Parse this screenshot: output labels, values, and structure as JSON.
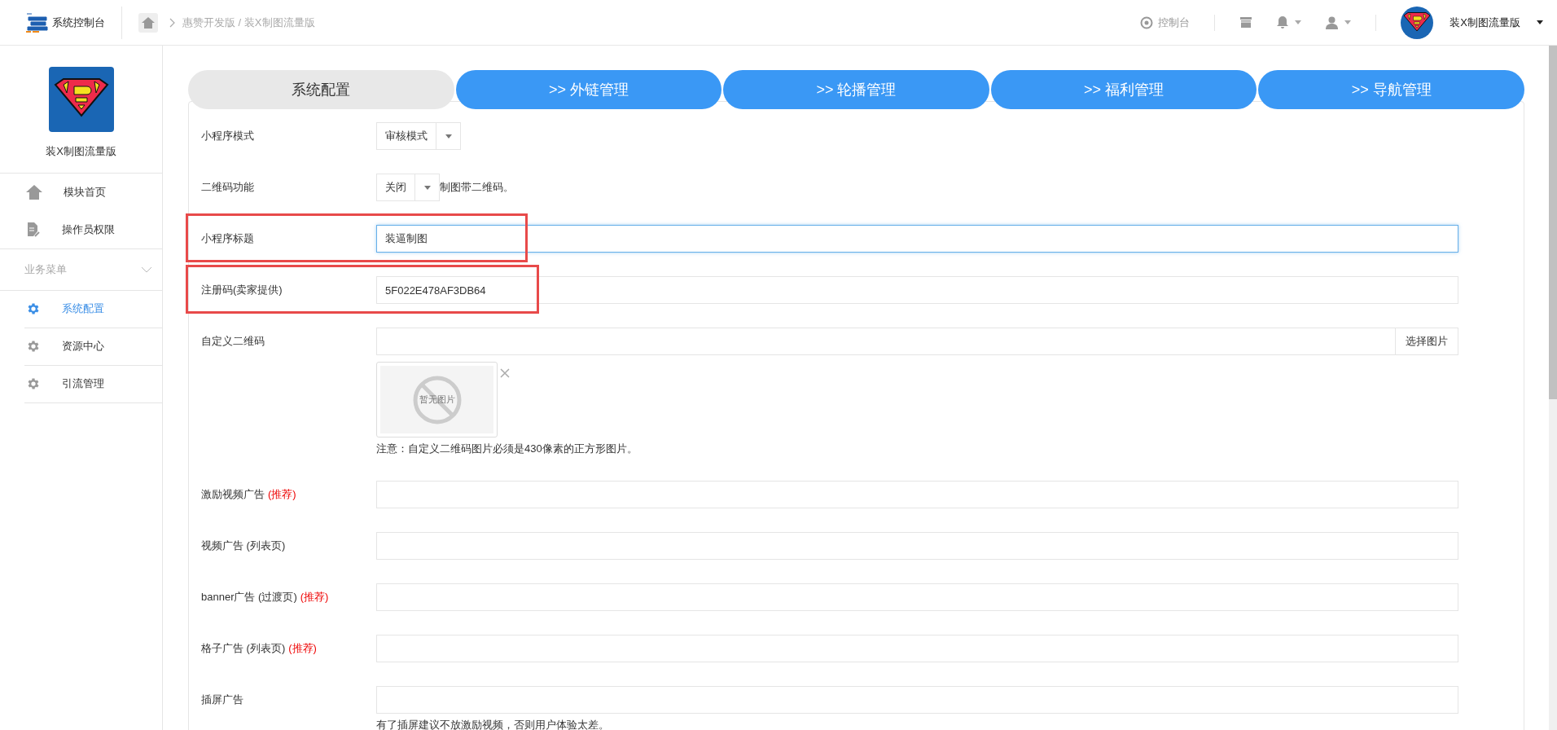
{
  "topbar": {
    "brand": "系统控制台",
    "breadcrumb": "惠赞开发版 / 装X制图流量版",
    "console": "控制台",
    "user_name": "装X制图流量版"
  },
  "sidebar": {
    "app_name": "装X制图流量版",
    "items": [
      {
        "label": "模块首页",
        "selected": false
      },
      {
        "label": "操作员权限",
        "selected": false
      }
    ],
    "section": {
      "label": "业务菜单",
      "expanded": true,
      "items": [
        {
          "label": "系统配置",
          "selected": true
        },
        {
          "label": "资源中心",
          "selected": false
        },
        {
          "label": "引流管理",
          "selected": false
        }
      ]
    }
  },
  "tabs": [
    {
      "label": "系统配置",
      "selected": true
    },
    {
      "label": ">> 外链管理",
      "selected": false
    },
    {
      "label": ">> 轮播管理",
      "selected": false
    },
    {
      "label": ">> 福利管理",
      "selected": false
    },
    {
      "label": ">> 导航管理",
      "selected": false
    }
  ],
  "form": [
    {
      "kind": "select",
      "label": "小程序模式",
      "value": "审核模式"
    },
    {
      "kind": "select",
      "label": "二维码功能",
      "value": "关闭",
      "suffix": "制图带二维码。"
    },
    {
      "kind": "text",
      "label": "小程序标题",
      "value": "装逼制图",
      "focused": true,
      "highlight": true
    },
    {
      "kind": "text",
      "label": "注册码(卖家提供)",
      "value": "5F022E478AF3DB64",
      "focused": false,
      "highlight": true
    },
    {
      "kind": "image",
      "label": "自定义二维码",
      "button": "选择图片",
      "placeholder_image": "暂无图片",
      "note": "注意：自定义二维码图片必须是430像素的正方形图片。"
    },
    {
      "kind": "text",
      "label": "激励视频广告",
      "tag": "(推荐)",
      "focused": false
    },
    {
      "kind": "text",
      "label": "视频广告 (列表页)",
      "focused": false
    },
    {
      "kind": "text",
      "label": "banner广告 (过渡页)",
      "tag": "(推荐)",
      "focused": false
    },
    {
      "kind": "text",
      "label": "格子广告 (列表页)",
      "tag": "(推荐)",
      "focused": false
    },
    {
      "kind": "text",
      "label": "插屏广告",
      "note": "有了插屏建议不放激励视频，否则用户体验太差。",
      "focused": false
    }
  ]
}
